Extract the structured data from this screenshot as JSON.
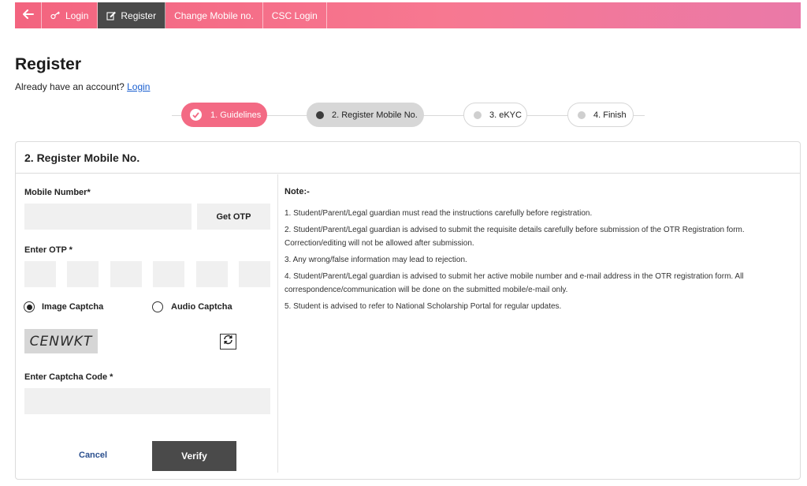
{
  "nav": {
    "back_icon": "arrow-left-icon",
    "items": [
      {
        "label": "Login",
        "icon": "key-icon"
      },
      {
        "label": "Register",
        "icon": "edit-icon",
        "active": true
      },
      {
        "label": "Change Mobile no."
      },
      {
        "label": "CSC Login"
      }
    ]
  },
  "page": {
    "title": "Register",
    "already_text": "Already have an account?",
    "login_link": "Login"
  },
  "stepper": {
    "steps": [
      {
        "label": "1. Guidelines",
        "state": "done"
      },
      {
        "label": "2. Register Mobile No.",
        "state": "current"
      },
      {
        "label": "3. eKYC",
        "state": "pending"
      },
      {
        "label": "4. Finish",
        "state": "pending"
      }
    ]
  },
  "form": {
    "card_title": "2. Register Mobile No.",
    "mobile_label": "Mobile Number*",
    "mobile_value": "",
    "get_otp": "Get OTP",
    "otp_label": "Enter OTP *",
    "otp_digits": [
      "",
      "",
      "",
      "",
      "",
      ""
    ],
    "captcha_options": [
      {
        "label": "Image Captcha",
        "selected": true
      },
      {
        "label": "Audio Captcha",
        "selected": false
      }
    ],
    "captcha_text": "CENWKT",
    "refresh_icon": "refresh-icon",
    "captcha_code_label": "Enter Captcha Code *",
    "captcha_code_value": "",
    "cancel": "Cancel",
    "verify": "Verify"
  },
  "note": {
    "title": "Note:-",
    "items": [
      "1. Student/Parent/Legal guardian must read the instructions carefully before registration.",
      "2. Student/Parent/Legal guardian is advised to submit the requisite details carefully before submission of the OTR Registration form. Correction/editing will not be allowed after submission.",
      "3. Any wrong/false information may lead to rejection.",
      "4. Student/Parent/Legal guardian is advised to submit her active mobile number and e-mail address in the OTR registration form. All correspondence/communication will be done on the submitted mobile/e-mail only.",
      "5. Student is advised to refer to National Scholarship Portal for regular updates."
    ]
  },
  "colors": {
    "nav_pink": "#f3647f",
    "active_dark": "#4a4a4a",
    "step_done": "#f36a84",
    "link_blue": "#1a5fd0"
  }
}
